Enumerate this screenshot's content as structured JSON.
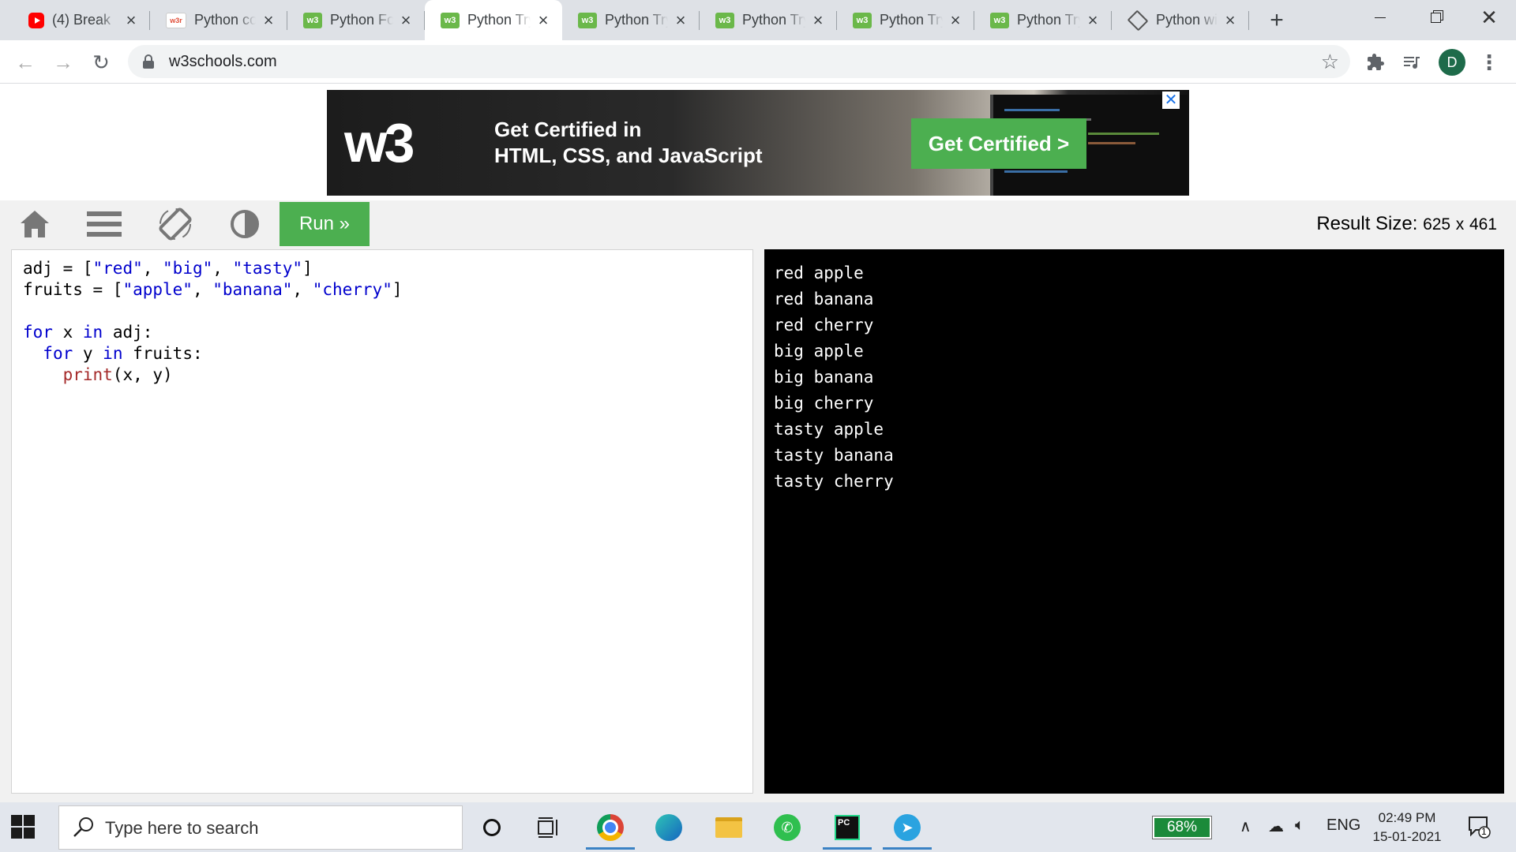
{
  "browser": {
    "tabs": [
      {
        "title": "(4) Break",
        "favicon": "youtube-icon",
        "active": false
      },
      {
        "title": "Python co",
        "favicon": "w3resource-icon",
        "active": false
      },
      {
        "title": "Python Fo",
        "favicon": "w3schools-icon",
        "active": false
      },
      {
        "title": "Python Try",
        "favicon": "w3schools-icon",
        "active": true
      },
      {
        "title": "Python Try",
        "favicon": "w3schools-icon",
        "active": false
      },
      {
        "title": "Python Try",
        "favicon": "w3schools-icon",
        "active": false
      },
      {
        "title": "Python Try",
        "favicon": "w3schools-icon",
        "active": false
      },
      {
        "title": "Python Try",
        "favicon": "w3schools-icon",
        "active": false
      },
      {
        "title": "Python wi",
        "favicon": "diamond-icon",
        "active": false
      }
    ],
    "url": "w3schools.com",
    "profile_initial": "D",
    "favicon_labels": {
      "w3r": "w3r",
      "w3": "w3"
    }
  },
  "ad": {
    "logo": "w3",
    "headline_line1": "Get Certified in",
    "headline_line2": "HTML, CSS, and JavaScript",
    "cta": "Get Certified >",
    "close": "✕"
  },
  "tryit": {
    "run_label": "Run »",
    "result_size_label": "Result Size:",
    "result_width": "625",
    "result_x": "x",
    "result_height": "461",
    "accent_color": "#4caf50"
  },
  "editor": {
    "lines": [
      "adj = [\"red\", \"big\", \"tasty\"]",
      "fruits = [\"apple\", \"banana\", \"cherry\"]",
      "",
      "for x in adj:",
      "  for y in fruits:",
      "    print(x, y)"
    ]
  },
  "output": {
    "lines": [
      "red apple",
      "red banana",
      "red cherry",
      "big apple",
      "big banana",
      "big cherry",
      "tasty apple",
      "tasty banana",
      "tasty cherry"
    ]
  },
  "taskbar": {
    "search_placeholder": "Type here to search",
    "battery": "68%",
    "language": "ENG",
    "time": "02:49 PM",
    "date": "15-01-2021",
    "notification_count": "1",
    "pycharm_label": "PC"
  }
}
